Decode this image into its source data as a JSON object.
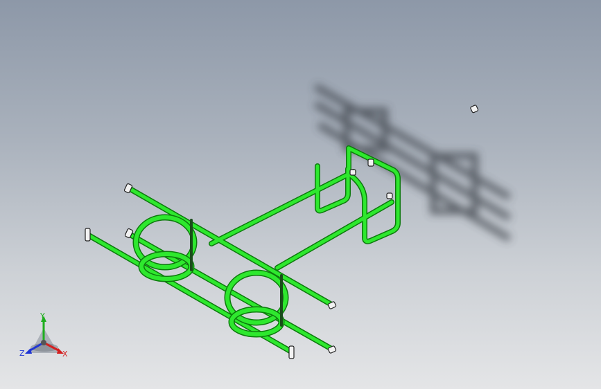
{
  "viewport": {
    "background_top": "#8d98a8",
    "background_bottom": "#e4e5e7",
    "model_color": "#2ee82e",
    "model_edge_color": "#0d7a0d",
    "shadow_color": "#3a3f47"
  },
  "triad": {
    "x_label": "X",
    "y_label": "Y",
    "z_label": "Z",
    "x_color": "#d42020",
    "y_color": "#1fae1f",
    "z_color": "#2036d4"
  },
  "icons": {
    "triad": "axis-triad-icon",
    "mounting_plate": "mounting-plate-icon"
  }
}
